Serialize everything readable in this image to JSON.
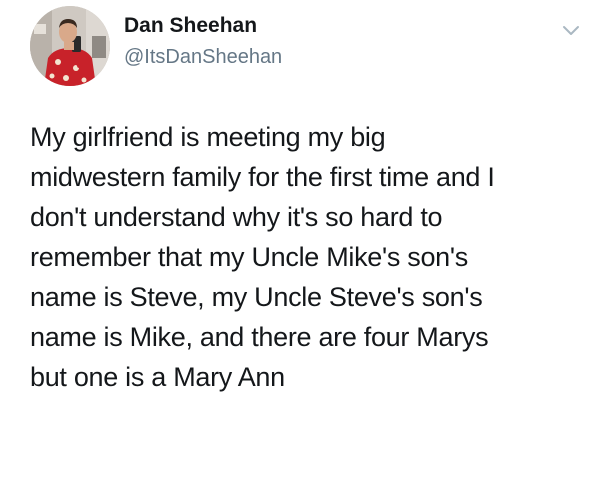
{
  "tweet": {
    "author": {
      "display_name": "Dan Sheehan",
      "handle": "@ItsDanSheehan",
      "avatar_icon": "avatar-photo"
    },
    "menu_icon": "chevron-down-icon",
    "text": "My girlfriend is meeting my big\nmidwestern family for the first time and I\ndon't understand why it's so hard to\nremember that my Uncle Mike's son's\nname is Steve, my Uncle Steve's son's\nname is Mike, and there are four Marys\nbut one is a Mary Ann"
  },
  "colors": {
    "background": "#ffffff",
    "text": "#14171a",
    "handle": "#657786",
    "caret": "#aab8c2",
    "shirt": "#c8222a"
  }
}
